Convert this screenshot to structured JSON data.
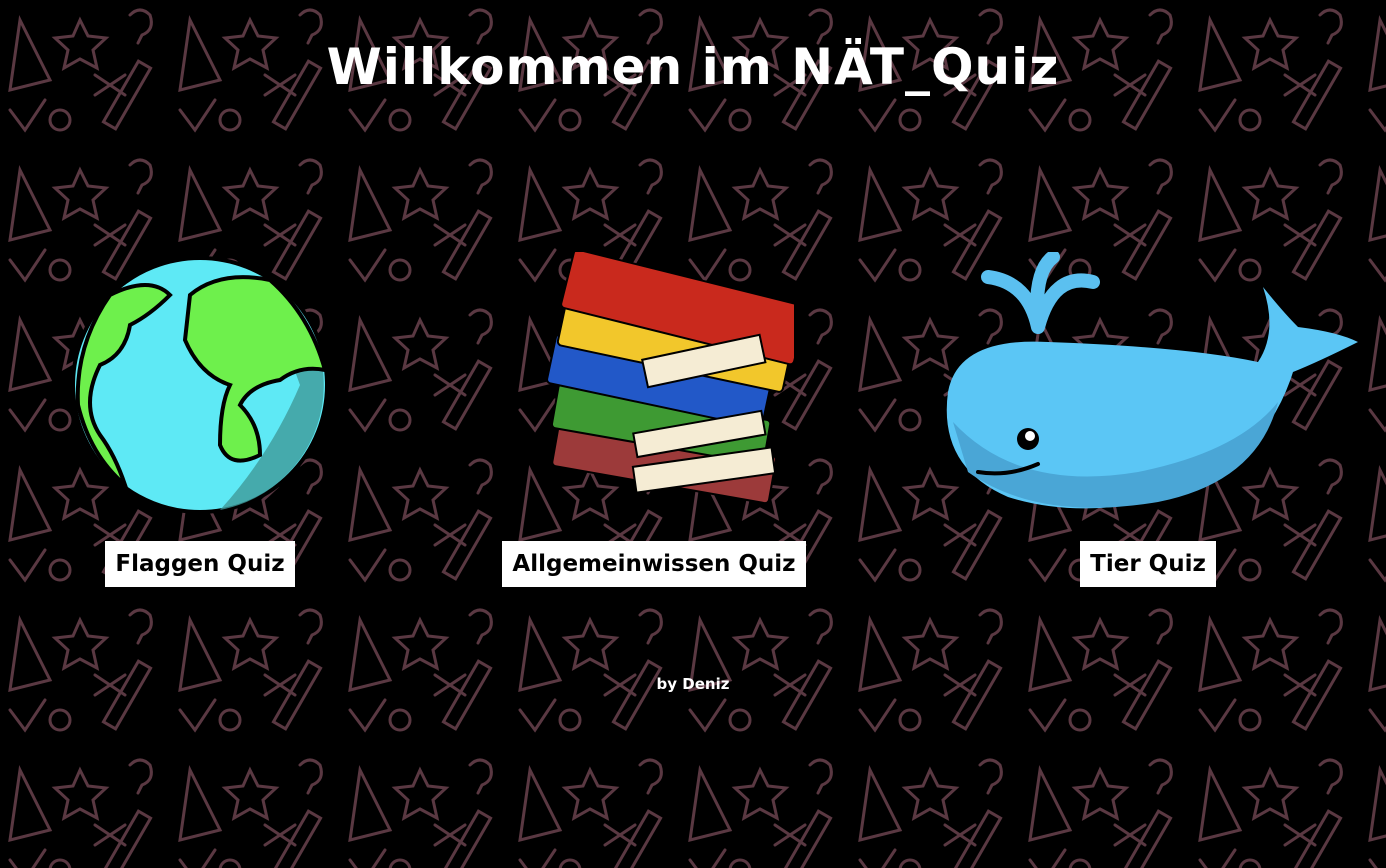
{
  "header": {
    "title": "Willkommen im NÄT_Quiz"
  },
  "quizzes": [
    {
      "label": "Flaggen Quiz",
      "icon": "globe-icon"
    },
    {
      "label": "Allgemeinwissen Quiz",
      "icon": "books-icon"
    },
    {
      "label": "Tier Quiz",
      "icon": "whale-icon"
    }
  ],
  "footer": {
    "author": "by Deniz"
  },
  "colors": {
    "background": "#000000",
    "pattern": "#5a3842",
    "button_bg": "#ffffff"
  }
}
